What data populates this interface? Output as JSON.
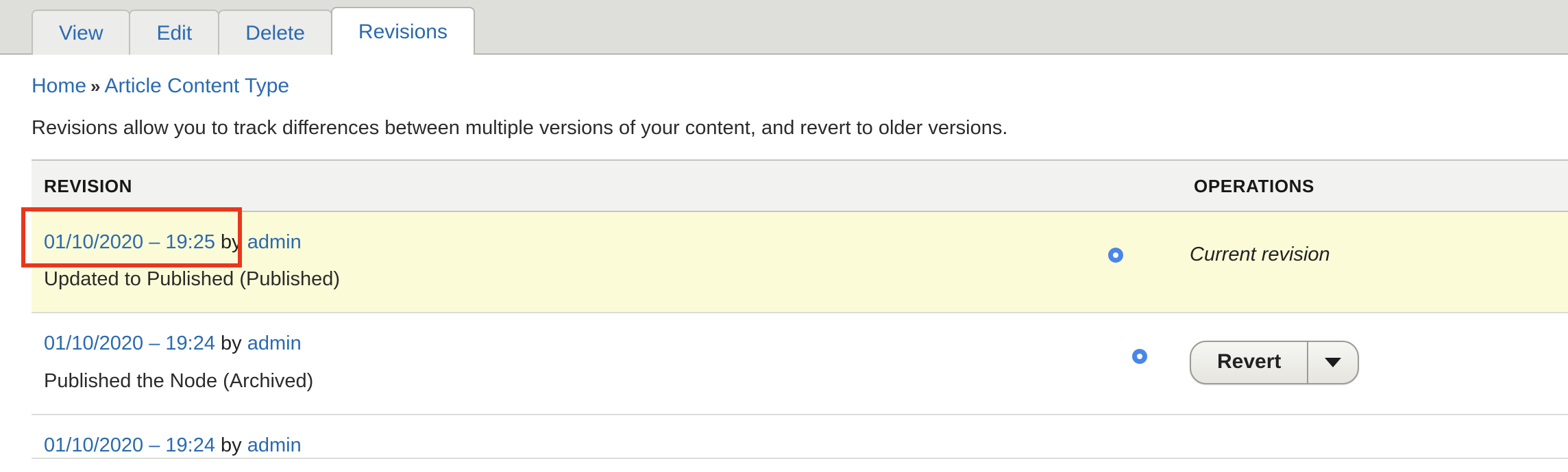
{
  "tabs": [
    {
      "label": "View",
      "active": false
    },
    {
      "label": "Edit",
      "active": false
    },
    {
      "label": "Delete",
      "active": false
    },
    {
      "label": "Revisions",
      "active": true
    }
  ],
  "breadcrumb": {
    "home": "Home",
    "separator": "»",
    "current": "Article Content Type"
  },
  "intro": "Revisions allow you to track differences between multiple versions of your content, and revert to older versions.",
  "table": {
    "headers": {
      "revision": "Revision",
      "operations": "Operations"
    },
    "rows": [
      {
        "date": "01/10/2020 – 19:25",
        "by": " by ",
        "author": "admin",
        "message": "Updated to Published (Published)",
        "radio_selected": true,
        "operation_text": "Current revision",
        "operation_type": "text",
        "highlighted": true
      },
      {
        "date": "01/10/2020 – 19:24",
        "by": " by ",
        "author": "admin",
        "message": "Published the Node (Archived)",
        "radio_selected": true,
        "operation_button": "Revert",
        "operation_type": "button",
        "highlighted": false
      },
      {
        "date": "01/10/2020 – 19:24",
        "by": " by ",
        "author": "admin",
        "message": "",
        "radio_selected": false,
        "operation_type": "none",
        "highlighted": false
      }
    ]
  },
  "annotation": {
    "type": "red-rectangle",
    "color": "#e8371c",
    "targets": "revision-date-link-row-1"
  }
}
